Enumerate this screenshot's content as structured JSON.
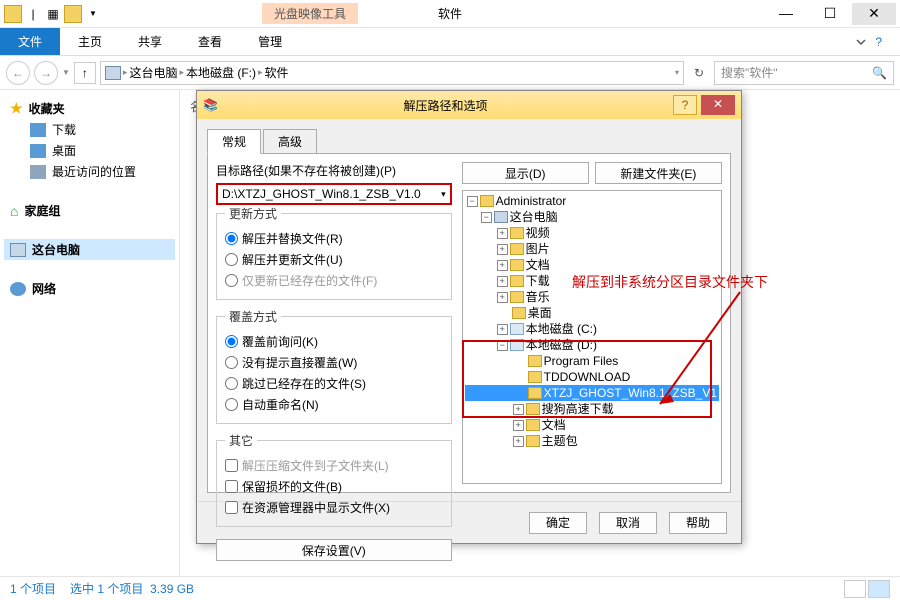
{
  "titlebar": {
    "tool_tab": "光盘映像工具",
    "title": "软件"
  },
  "ribbon": {
    "file": "文件",
    "home": "主页",
    "share": "共享",
    "view": "查看",
    "manage": "管理"
  },
  "address": {
    "seg1": "这台电脑",
    "seg2": "本地磁盘 (F:)",
    "seg3": "软件",
    "search_placeholder": "搜索\"软件\""
  },
  "nav": {
    "favorites": "收藏夹",
    "downloads": "下载",
    "desktop": "桌面",
    "recent": "最近访问的位置",
    "homegroup": "家庭组",
    "computer": "这台电脑",
    "network": "网络"
  },
  "status": {
    "items": "1 个项目",
    "selected": "选中 1 个项目",
    "size": "3.39 GB"
  },
  "dlg": {
    "title": "解压路径和选项",
    "tab_general": "常规",
    "tab_advanced": "高级",
    "target_label": "目标路径(如果不存在将被创建)(P)",
    "target_value": "D:\\XTZJ_GHOST_Win8.1_ZSB_V1.0",
    "show_btn": "显示(D)",
    "newfolder_btn": "新建文件夹(E)",
    "update_legend": "更新方式",
    "update_opt1": "解压并替换文件(R)",
    "update_opt2": "解压并更新文件(U)",
    "update_opt3": "仅更新已经存在的文件(F)",
    "overwrite_legend": "覆盖方式",
    "overwrite_opt1": "覆盖前询问(K)",
    "overwrite_opt2": "没有提示直接覆盖(W)",
    "overwrite_opt3": "跳过已经存在的文件(S)",
    "overwrite_opt4": "自动重命名(N)",
    "other_legend": "其它",
    "other_opt1": "解压压缩文件到子文件夹(L)",
    "other_opt2": "保留损坏的文件(B)",
    "other_opt3": "在资源管理器中显示文件(X)",
    "save_settings": "保存设置(V)",
    "ok": "确定",
    "cancel": "取消",
    "help": "帮助",
    "tree": {
      "admin": "Administrator",
      "pc": "这台电脑",
      "video": "视频",
      "pictures": "图片",
      "documents": "文档",
      "downloads": "下载",
      "music": "音乐",
      "desktop": "桌面",
      "drive_c": "本地磁盘 (C:)",
      "drive_d": "本地磁盘 (D:)",
      "pf": "Program Files",
      "td": "TDDOWNLOAD",
      "xtzj": "XTZJ_GHOST_Win8.1_ZSB_V1",
      "sogou": "搜狗高速下载",
      "wendang": "文档",
      "zhutibao": "主题包"
    }
  },
  "annotation": "解压到非系统分区目录文件夹下"
}
